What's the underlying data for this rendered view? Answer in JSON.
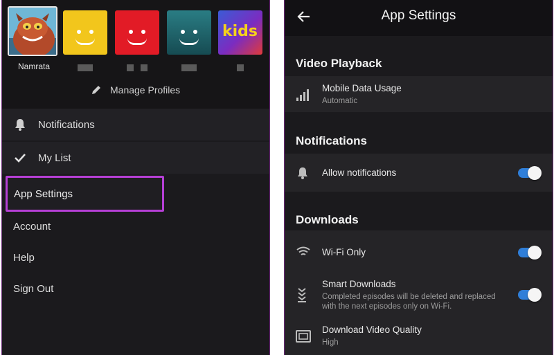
{
  "left_panel": {
    "profiles": [
      {
        "name": "Namrata",
        "type": "custom-avatar",
        "selected": true
      },
      {
        "name": "",
        "color": "#f2c61c",
        "type": "smiley"
      },
      {
        "name": "",
        "color": "#e21b26",
        "type": "smiley"
      },
      {
        "name": "",
        "color": "#1f6e74",
        "type": "smiley"
      },
      {
        "name": "",
        "avatar_text": "kids",
        "type": "kids"
      }
    ],
    "manage_profiles_label": "Manage Profiles",
    "menu": {
      "notifications": "Notifications",
      "my_list": "My List",
      "app_settings": "App Settings",
      "account": "Account",
      "help": "Help",
      "sign_out": "Sign Out"
    },
    "highlight_color": "#b63fd6"
  },
  "right_panel": {
    "title": "App Settings",
    "sections": {
      "video_playback": {
        "heading": "Video Playback",
        "mobile_data_usage": {
          "title": "Mobile Data Usage",
          "subtitle": "Automatic"
        }
      },
      "notifications": {
        "heading": "Notifications",
        "allow_notifications": {
          "title": "Allow notifications",
          "enabled": true
        }
      },
      "downloads": {
        "heading": "Downloads",
        "wifi_only": {
          "title": "Wi-Fi Only",
          "enabled": true
        },
        "smart_downloads": {
          "title": "Smart Downloads",
          "subtitle_line1": "Completed episodes will be deleted and replaced",
          "subtitle_line2": "with the next episodes only on Wi-Fi.",
          "enabled": true
        },
        "download_video_quality": {
          "title": "Download Video Quality",
          "subtitle": "High"
        }
      }
    },
    "toggle_color": "#2f7ed8"
  }
}
